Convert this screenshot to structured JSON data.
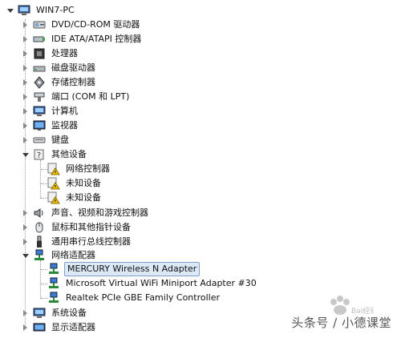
{
  "root": {
    "label": "WIN7-PC",
    "icon": "computer-icon"
  },
  "categories": [
    {
      "label": "DVD/CD-ROM 驱动器",
      "icon": "dvd-drive-icon",
      "state": "collapsed"
    },
    {
      "label": "IDE ATA/ATAPI 控制器",
      "icon": "ide-controller-icon",
      "state": "collapsed"
    },
    {
      "label": "处理器",
      "icon": "processor-icon",
      "state": "collapsed"
    },
    {
      "label": "磁盘驱动器",
      "icon": "disk-drive-icon",
      "state": "collapsed"
    },
    {
      "label": "存储控制器",
      "icon": "storage-controller-icon",
      "state": "collapsed"
    },
    {
      "label": "端口 (COM 和 LPT)",
      "icon": "port-icon",
      "state": "collapsed"
    },
    {
      "label": "计算机",
      "icon": "computer-icon",
      "state": "collapsed"
    },
    {
      "label": "监视器",
      "icon": "monitor-icon",
      "state": "collapsed"
    },
    {
      "label": "键盘",
      "icon": "keyboard-icon",
      "state": "collapsed"
    },
    {
      "label": "其他设备",
      "icon": "other-devices-icon",
      "state": "expanded",
      "children": [
        {
          "label": "网络控制器",
          "icon": "unknown-device-warning-icon"
        },
        {
          "label": "未知设备",
          "icon": "unknown-device-warning-icon"
        },
        {
          "label": "未知设备",
          "icon": "unknown-device-warning-icon"
        }
      ]
    },
    {
      "label": "声音、视频和游戏控制器",
      "icon": "sound-icon",
      "state": "collapsed"
    },
    {
      "label": "鼠标和其他指针设备",
      "icon": "mouse-icon",
      "state": "collapsed"
    },
    {
      "label": "通用串行总线控制器",
      "icon": "usb-icon",
      "state": "collapsed"
    },
    {
      "label": "网络适配器",
      "icon": "network-adapter-icon",
      "state": "expanded",
      "children": [
        {
          "label": "MERCURY Wireless N Adapter",
          "icon": "network-adapter-icon",
          "selected": true
        },
        {
          "label": "Microsoft Virtual WiFi Miniport Adapter #30",
          "icon": "network-adapter-icon"
        },
        {
          "label": "Realtek PCIe GBE Family Controller",
          "icon": "network-adapter-icon"
        }
      ]
    },
    {
      "label": "系统设备",
      "icon": "system-devices-icon",
      "state": "collapsed"
    },
    {
      "label": "显示适配器",
      "icon": "display-adapter-icon",
      "state": "collapsed"
    }
  ],
  "watermark": {
    "text": "头条号 / 小德课堂",
    "logo_text": "Bai经验"
  },
  "colors": {
    "selection_bg": "#dbe9f7",
    "selection_border": "#7da2ce",
    "warning": "#f2c200"
  }
}
